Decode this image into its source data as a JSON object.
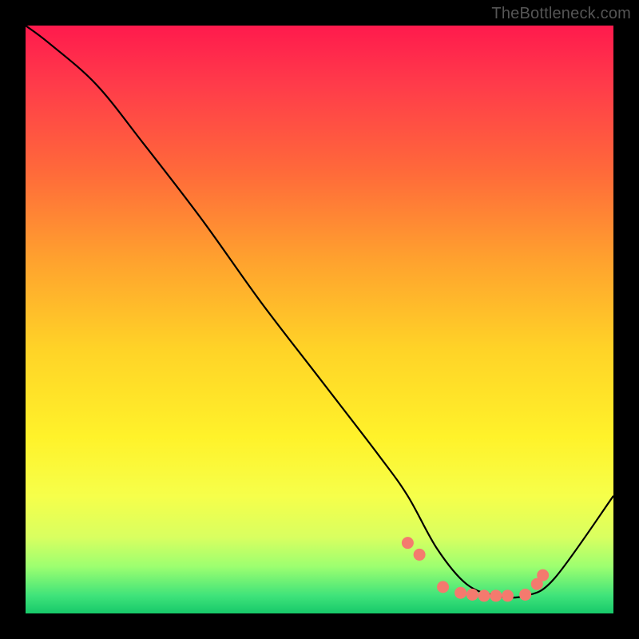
{
  "watermark": "TheBottleneck.com",
  "colors": {
    "frame": "#000000",
    "curve": "#000000",
    "dot": "#f47a6e",
    "gradient_top": "#ff1a4d",
    "gradient_bottom": "#17c96a"
  },
  "chart_data": {
    "type": "line",
    "title": "",
    "xlabel": "",
    "ylabel": "",
    "xlim": [
      0,
      100
    ],
    "ylim": [
      0,
      100
    ],
    "curve": {
      "x": [
        0,
        4,
        12,
        20,
        30,
        40,
        50,
        60,
        65,
        70,
        75,
        80,
        85,
        90,
        100
      ],
      "y": [
        100,
        97,
        90,
        80,
        67,
        53,
        40,
        27,
        20,
        11,
        5,
        3,
        3,
        6,
        20
      ]
    },
    "markers": {
      "x": [
        65,
        67,
        71,
        74,
        76,
        78,
        80,
        82,
        85,
        87,
        88
      ],
      "y": [
        12,
        10,
        4.5,
        3.5,
        3.2,
        3,
        3,
        3,
        3.2,
        5,
        6.5
      ]
    }
  }
}
